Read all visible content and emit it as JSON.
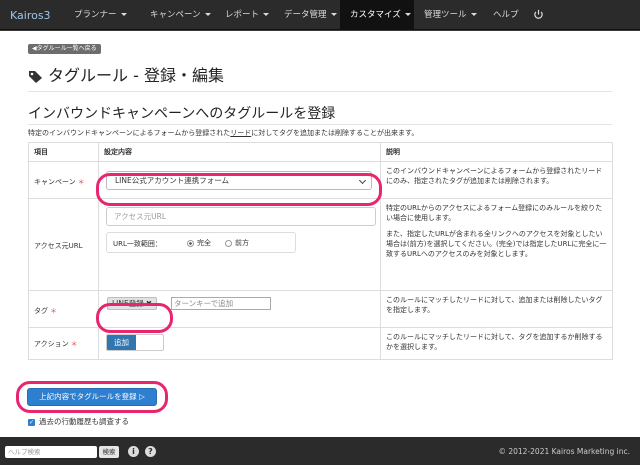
{
  "nav": {
    "brand": "Kairos3",
    "items": [
      "プランナー",
      "キャンペーン",
      "レポート",
      "データ管理",
      "カスタマイズ",
      "管理ツール",
      "ヘルプ"
    ]
  },
  "back_button": "◀タグルール一覧へ戻る",
  "page_title": "タグルール - 登録・編集",
  "section": {
    "title": "インバウンドキャンペーンへのタグルールを登録",
    "desc_before": "特定のインバウンドキャンペーンによるフォームから登録された",
    "desc_link": "リード",
    "desc_after": "に対してタグを追加または削除することが出来ます。"
  },
  "table": {
    "headers": [
      "項目",
      "設定内容",
      "説明"
    ],
    "rows": {
      "campaign": {
        "label": "キャンペーン",
        "select_value": "LINE公式アカウント連携フォーム",
        "desc": "このインバウンドキャンペーンによるフォームから登録されたリードにのみ、指定されたタグが追加または削除されます。"
      },
      "access_url": {
        "label": "アクセス元URL",
        "input_placeholder": "アクセス元URL",
        "match_label": "URL一致範囲：",
        "options": [
          "完全",
          "前方"
        ],
        "desc1": "特定のURLからのアクセスによるフォーム登録にのみルールを絞りたい場合に使用します。",
        "desc2": "また、指定したURLが含まれる全リンクへのアクセスを対象としたい場合は(前方)を選択してください。(完全)では指定したURLに完全に一致するURLへのアクセスのみを対象とします。"
      },
      "tag": {
        "label": "タグ",
        "chip": "LINE登録",
        "chip_close": "✖",
        "input_placeholder": "ターンキーで追加",
        "desc": "このルールにマッチしたリードに対して、追加または削除したいタグを指定します。"
      },
      "action": {
        "label": "アクション",
        "toggle_value": "追加",
        "desc": "このルールにマッチしたリードに対して、タグを追加するか削除するかを選択します。"
      }
    },
    "required_mark": "＊"
  },
  "submit_button": "上記内容でタグルールを登録 ▷",
  "history_checkbox": "過去の行動履歴も調査する",
  "footer": {
    "help_placeholder": "ヘルプ検索",
    "search_button": "検索",
    "copyright": "© 2012-2021 Kairos Marketing inc."
  },
  "colors": {
    "navbar": "#2b2b2b",
    "highlight": "#e8256f",
    "primary": "#2f7fd0",
    "required": "#d9534f"
  },
  "icons": [
    "tag-icon",
    "power-icon",
    "info-icon",
    "question-icon",
    "checkbox-icon",
    "close-icon"
  ]
}
